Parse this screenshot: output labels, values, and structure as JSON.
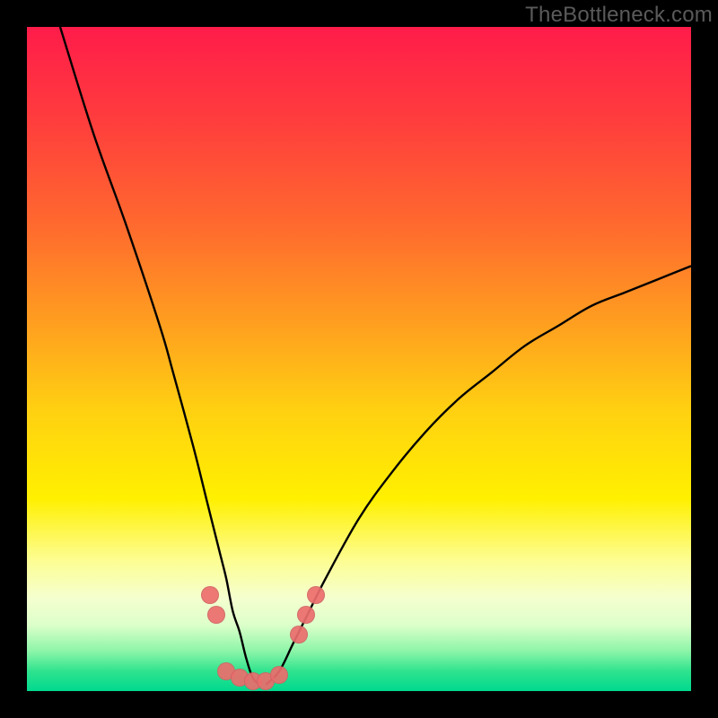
{
  "watermark": "TheBottleneck.com",
  "colors": {
    "gradient_top": "#ff1c4a",
    "gradient_mid": "#fff000",
    "gradient_bottom": "#00d98f",
    "curve_stroke": "#000000",
    "marker_fill": "#eb6d6d",
    "frame_bg": "#000000"
  },
  "chart_data": {
    "type": "line",
    "title": "",
    "xlabel": "",
    "ylabel": "",
    "xlim": [
      0,
      100
    ],
    "ylim": [
      0,
      100
    ],
    "note": "y = 100 top (red), y = 0 bottom (green). Two V-shaped curves dipping near x≈34.",
    "series": [
      {
        "name": "left_arm",
        "x": [
          5,
          10,
          15,
          20,
          22,
          25,
          27,
          29,
          30,
          31,
          32,
          33,
          34,
          35
        ],
        "y": [
          100,
          84,
          70,
          55,
          48,
          37,
          29,
          21,
          17,
          12,
          9,
          5,
          2,
          1
        ]
      },
      {
        "name": "right_arm",
        "x": [
          36,
          38,
          40,
          42,
          45,
          50,
          55,
          60,
          65,
          70,
          75,
          80,
          85,
          90,
          95,
          100
        ],
        "y": [
          1,
          3,
          7,
          11,
          17,
          26,
          33,
          39,
          44,
          48,
          52,
          55,
          58,
          60,
          62,
          64
        ]
      }
    ],
    "markers": [
      {
        "name": "left-upper-a",
        "x": 27.5,
        "y": 14.5
      },
      {
        "name": "left-upper-b",
        "x": 28.5,
        "y": 11.5
      },
      {
        "name": "valley-1",
        "x": 30.0,
        "y": 3.0
      },
      {
        "name": "valley-2",
        "x": 32.0,
        "y": 2.0
      },
      {
        "name": "valley-3",
        "x": 34.0,
        "y": 1.5
      },
      {
        "name": "valley-4",
        "x": 36.0,
        "y": 1.5
      },
      {
        "name": "valley-5",
        "x": 38.0,
        "y": 2.5
      },
      {
        "name": "right-upper-a",
        "x": 41.0,
        "y": 8.5
      },
      {
        "name": "right-upper-b",
        "x": 42.0,
        "y": 11.5
      },
      {
        "name": "right-upper-c",
        "x": 43.5,
        "y": 14.5
      }
    ]
  }
}
